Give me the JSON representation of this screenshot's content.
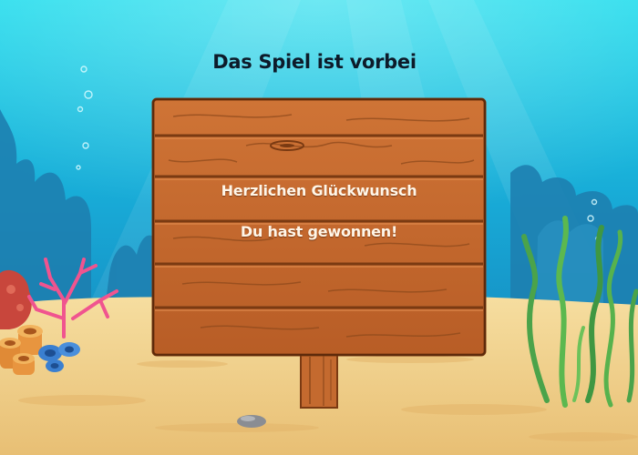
{
  "game": {
    "title": "Das Spiel ist vorbei",
    "message_line1": "Herzlichen Glückwunsch",
    "message_line2": "Du hast gewonnen!"
  },
  "colors": {
    "water_top": "#1fd6ea",
    "water_mid": "#1795c8",
    "sand": "#f0cf8a",
    "wood": "#c0692f",
    "wood_dark": "#7a3a12"
  }
}
